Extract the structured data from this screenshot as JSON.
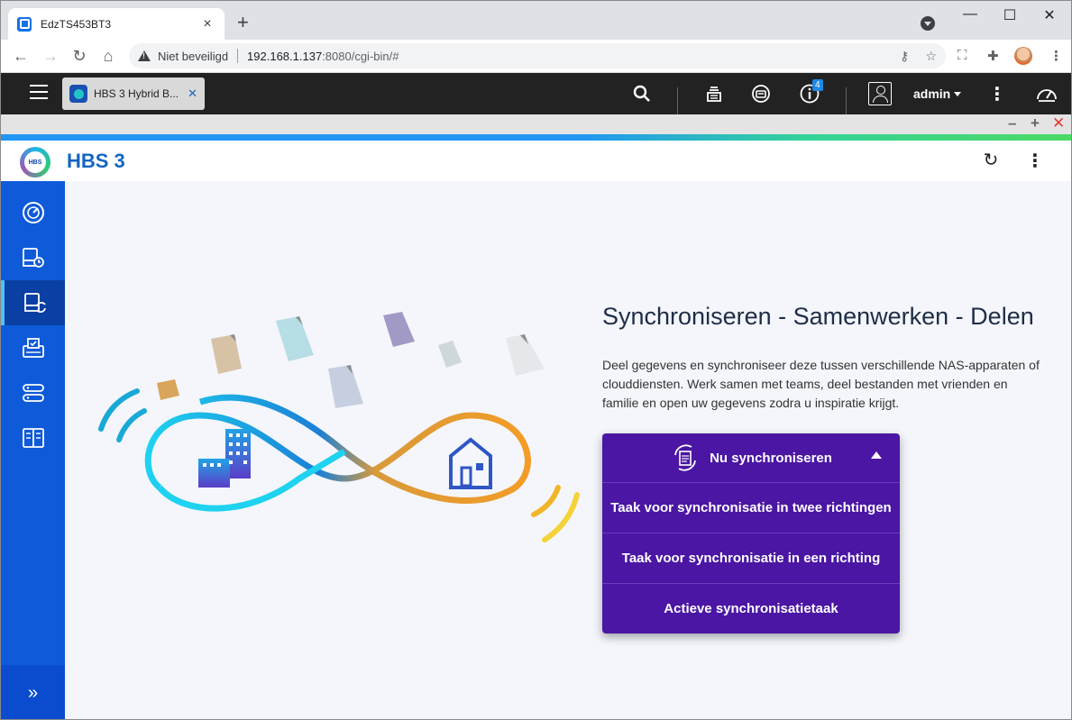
{
  "browser": {
    "tab_title": "EdzTS453BT3",
    "new_tab_symbol": "+",
    "window_controls": {
      "minimize": "—",
      "maximize": "☐",
      "close": "✕"
    },
    "security_label": "Niet beveiligd",
    "url_host": "192.168.1.137",
    "url_rest": ":8080/cgi-bin/#"
  },
  "qts": {
    "app_tab_label": "HBS 3 Hybrid B...",
    "notification_count": "4",
    "user": "admin"
  },
  "app": {
    "title": "HBS 3"
  },
  "sidebar": {
    "items": [
      {
        "icon": "dashboard-icon"
      },
      {
        "icon": "backup-restore-icon"
      },
      {
        "icon": "sync-icon",
        "active": true
      },
      {
        "icon": "tasks-icon"
      },
      {
        "icon": "storage-icon"
      },
      {
        "icon": "services-icon"
      }
    ],
    "expand_symbol": "»"
  },
  "main": {
    "heading": "Synchroniseren - Samenwerken - Delen",
    "description": "Deel gegevens en synchroniseer deze tussen verschillende NAS-apparaten of clouddiensten. Werk samen met teams, deel bestanden met vrienden en familie en open uw gegevens zodra u inspiratie krijgt.",
    "menu": {
      "header": "Nu synchroniseren",
      "items": [
        "Taak voor synchronisatie in twee richtingen",
        "Taak voor synchronisatie in een richting",
        "Actieve synchronisatietaak"
      ]
    }
  },
  "colors": {
    "sidebar": "#0e5ad8",
    "menu": "#4a16a3",
    "title_blue": "#1565c0"
  }
}
